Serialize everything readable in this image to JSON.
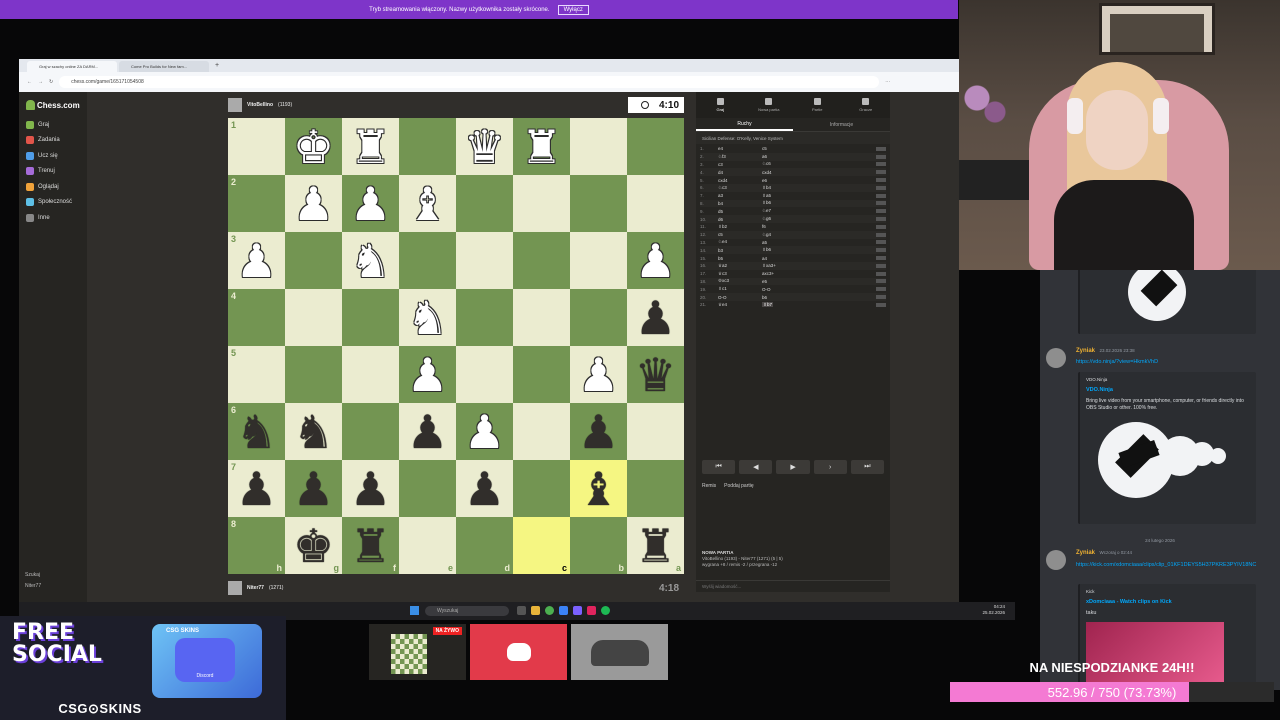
{
  "notice": {
    "text": "Tryb streamowania włączony. Nazwy użytkownika zostały skrócone.",
    "button": "Wyłącz"
  },
  "browser": {
    "tabs": [
      "Graj w szachy online ZA DARM...",
      "Come Pro Builds for New fam..."
    ],
    "url": "chess.com/game/165171054508"
  },
  "nav": {
    "logo": "Chess.com",
    "items": [
      {
        "label": "Graj",
        "color": "#81b64c"
      },
      {
        "label": "Zadania",
        "color": "#e2554a"
      },
      {
        "label": "Ucz się",
        "color": "#4f9de8"
      },
      {
        "label": "Trenuj",
        "color": "#a56bd8"
      },
      {
        "label": "Oglądaj",
        "color": "#f0a23a"
      },
      {
        "label": "Społeczność",
        "color": "#5ec0e6"
      },
      {
        "label": "Inne",
        "color": "#888888"
      }
    ],
    "bottom": [
      "Szukaj",
      "Niter77"
    ]
  },
  "players": {
    "top": {
      "name": "VitoBellino",
      "rating": "(1193)",
      "clock": "4:10"
    },
    "bottom": {
      "name": "Niter77",
      "rating": "(1271)",
      "clock": "4:18"
    }
  },
  "board": {
    "ranks": [
      "1",
      "2",
      "3",
      "4",
      "5",
      "6",
      "7",
      "8"
    ],
    "files": [
      "h",
      "g",
      "f",
      "e",
      "d",
      "c",
      "b",
      "a"
    ],
    "rows": [
      [
        "",
        "wK",
        "wR",
        "",
        "wQ",
        "wR",
        "",
        ""
      ],
      [
        "",
        "wP",
        "wP",
        "wB",
        "",
        "",
        "",
        ""
      ],
      [
        "wP",
        "",
        "wN",
        "",
        "",
        "",
        "",
        "wP"
      ],
      [
        "",
        "",
        "",
        "wN",
        "",
        "",
        "",
        "bP"
      ],
      [
        "",
        "",
        "",
        "wP",
        "",
        "",
        "wP",
        "bQ"
      ],
      [
        "bN",
        "bN",
        "",
        "bP",
        "wP",
        "",
        "bP",
        ""
      ],
      [
        "bP",
        "bP",
        "bP",
        "",
        "bP",
        "",
        "bB",
        ""
      ],
      [
        "",
        "bK",
        "bR",
        "",
        "",
        "",
        "",
        "bR"
      ]
    ],
    "highlight": [
      [
        6,
        6
      ],
      [
        7,
        5
      ]
    ]
  },
  "panel": {
    "tabs": [
      "Graj",
      "Nowa partia",
      "Partie",
      "Gracze"
    ],
    "subtabs": [
      "Ruchy",
      "Informacje"
    ],
    "opening": "Sicilian Defense: O'Kelly, Venice System",
    "moves": [
      [
        "1.",
        "e4",
        "c5"
      ],
      [
        "2.",
        "♘f3",
        "a6"
      ],
      [
        "3.",
        "c3",
        "♘c6"
      ],
      [
        "4.",
        "d4",
        "cxd4"
      ],
      [
        "5.",
        "cxd4",
        "e6"
      ],
      [
        "6.",
        "♘c3",
        "♗b4"
      ],
      [
        "7.",
        "a3",
        "♗a5"
      ],
      [
        "8.",
        "b4",
        "♗b6"
      ],
      [
        "9.",
        "d5",
        "♘e7"
      ],
      [
        "10.",
        "d6",
        "♘g6"
      ],
      [
        "11.",
        "♗b2",
        "f6"
      ],
      [
        "12.",
        "c5",
        "♘g4"
      ],
      [
        "13.",
        "♘e4",
        "a5"
      ],
      [
        "14.",
        "b3",
        "♗b6"
      ],
      [
        "15.",
        "b5",
        "a4"
      ],
      [
        "16.",
        "♕a2",
        "♗xa3+"
      ],
      [
        "17.",
        "♕c3",
        "axc3+"
      ],
      [
        "18.",
        "♔xc3",
        "e5"
      ],
      [
        "19.",
        "♗c1",
        "O-O"
      ],
      [
        "20.",
        "O-O",
        "b6"
      ],
      [
        "21.",
        "♕e4",
        "♗b7"
      ]
    ],
    "controls": [
      "⏮",
      "◀",
      "▶",
      "›",
      "⏭"
    ],
    "offers": [
      "Remis",
      "Poddaj partię"
    ],
    "game_title": "NOWA PARTIA",
    "game_line1": "VitoBellino (1193) - Niter77 (1271) (5 | 5)",
    "game_line2": "wygrana +8 / remis -2 / przegrana -12",
    "chat_placeholder": "Wyślij wiadomość..."
  },
  "taskbar": {
    "search": "Wyszukaj",
    "time": "04:24",
    "date": "25.02.2026"
  },
  "discord": {
    "messages": [
      {
        "user": "Zyniak",
        "time": "23.02.2026 23:38",
        "link": "https://vdo.ninja/?view=HkmkVhD",
        "embed_site": "VDO.Ninja",
        "embed_title": "VDO.Ninja",
        "embed_desc": "Bring live video from your smartphone, computer, or friends directly into OBS Studio or other. 100% free."
      },
      {
        "user": "Zyniak",
        "time": "Wczoraj o 02:44",
        "link": "https://kick.com/xdomciaaa/clips/clip_01KF1DEYS5H37PKRE3PYIV18NC",
        "embed_site": "Kick",
        "embed_title": "xDomciaaa - Watch clips on Kick",
        "embed_desc": "taku"
      }
    ],
    "separator": "24 lutego 2026"
  },
  "overlay": {
    "free_social_line1": "FREE",
    "free_social_line2": "SOCIAL",
    "box_label": "CSG SKINS",
    "box_sub": "Discord",
    "brand": "CSG⊙SKINS",
    "live_label": "NA ŻYWO",
    "goal_title": "NA NIESPODZIANKE 24H!!",
    "goal_text": "552.96 / 750 (73.73%)",
    "goal_fraction": 0.7373
  },
  "colors": {
    "accent": "#81b64c",
    "notice": "#7e35c9",
    "goal": "#f47ad3",
    "link": "#00a8fc",
    "username": "#f0b232"
  }
}
